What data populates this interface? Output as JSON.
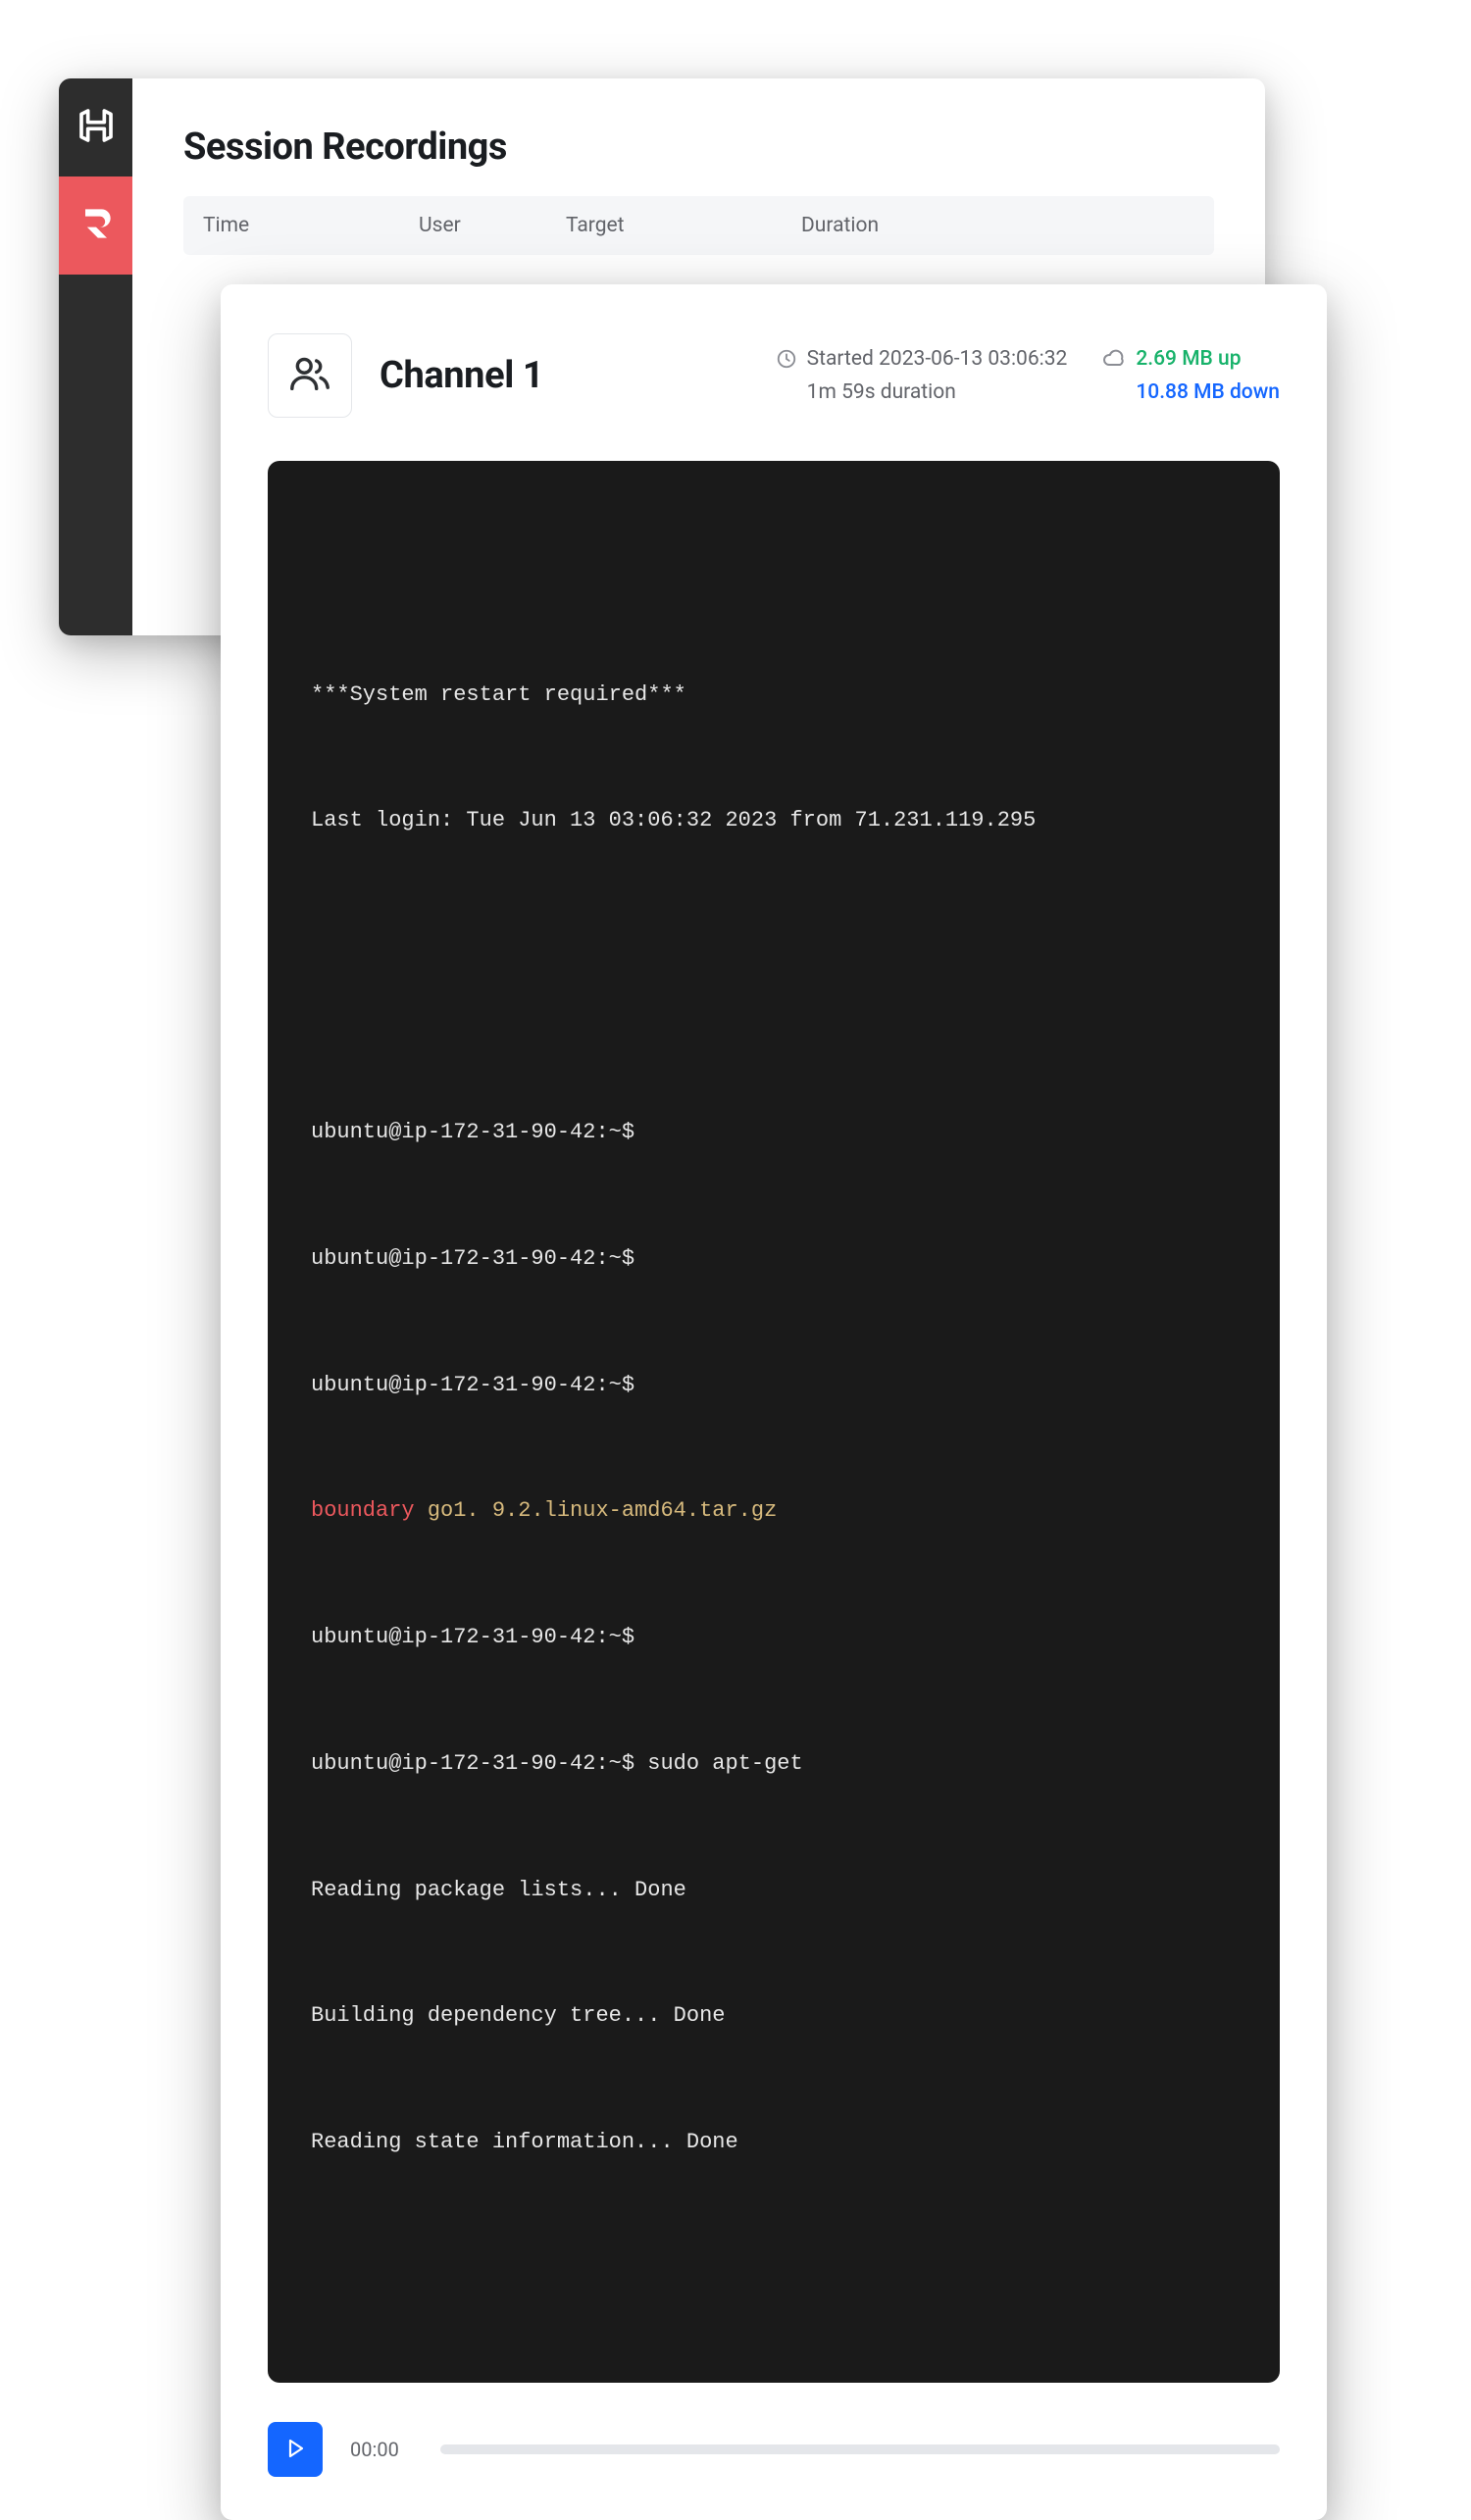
{
  "back": {
    "title": "Session Recordings",
    "columns": {
      "time": "Time",
      "user": "User",
      "target": "Target",
      "duration": "Duration"
    }
  },
  "sidebar": {
    "items": [
      {
        "name": "hashicorp-icon"
      },
      {
        "name": "boundary-icon"
      }
    ]
  },
  "channel": {
    "title": "Channel 1",
    "started_label": "Started 2023-06-13 03:06:32",
    "duration_label": "1m 59s duration",
    "up_label": "2.69 MB up",
    "down_label": "10.88 MB down"
  },
  "terminal": {
    "banner1": "***System restart required***",
    "banner2": "Last login: Tue Jun 13 03:06:32 2023 from 71.231.119.295",
    "p1": "ubuntu@ip-172-31-90-42:~$",
    "p2": "ubuntu@ip-172-31-90-42:~$",
    "p3": "ubuntu@ip-172-31-90-42:~$",
    "red_word": "boundary",
    "yellow_rest": " go1. 9.2.linux-amd64.tar.gz",
    "p4": "ubuntu@ip-172-31-90-42:~$",
    "p5": "ubuntu@ip-172-31-90-42:~$ sudo apt-get",
    "l1": "Reading package lists... Done",
    "l2": "Building dependency tree... Done",
    "l3": "Reading state information... Done"
  },
  "player": {
    "time": "00:00"
  },
  "colors": {
    "accent": "#1466ff",
    "brand_red": "#ec585d",
    "success": "#17b26a"
  }
}
